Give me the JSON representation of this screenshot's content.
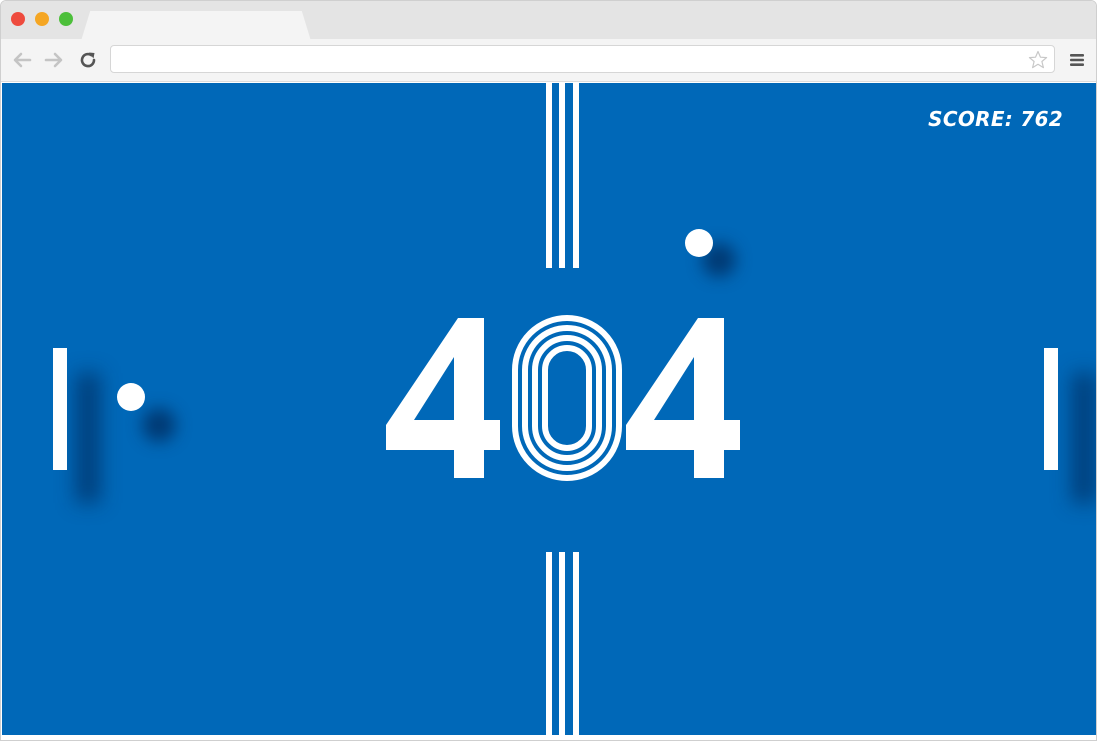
{
  "browser": {
    "tab_title": "",
    "url": "",
    "url_placeholder": ""
  },
  "game": {
    "score_text": "SCORE: 762",
    "error_code": "404",
    "colors": {
      "background": "#0068b8",
      "foreground": "#ffffff"
    }
  }
}
